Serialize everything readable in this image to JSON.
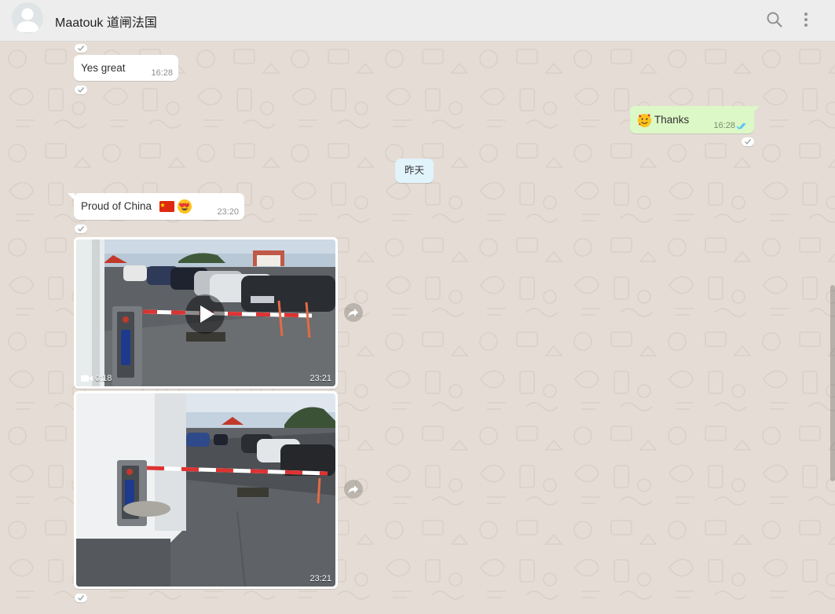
{
  "header": {
    "contact_name": "Maatouk 道闸法国",
    "icons": [
      "avatar-default-icon",
      "search-icon",
      "menu-dots-icon"
    ]
  },
  "messages": [
    {
      "dir": "in",
      "text": "Yes great",
      "time": "16:28"
    },
    {
      "dir": "out",
      "emoji": "smiling-face-with-hearts",
      "text": "Thanks",
      "time": "16:28",
      "status": "read"
    },
    {
      "type": "date",
      "text": "昨天"
    },
    {
      "dir": "in",
      "text": "Proud of China",
      "emojis": [
        "china-flag",
        "heart-eyes"
      ],
      "time": "23:20"
    },
    {
      "dir": "in",
      "type": "video",
      "duration": "0:18",
      "time": "23:21"
    },
    {
      "dir": "in",
      "type": "image",
      "time": "23:21"
    }
  ],
  "colors": {
    "header_bg": "#ededed",
    "chat_bg": "#e5ddd5",
    "incoming_bubble": "#ffffff",
    "outgoing_bubble": "#dcf8c6",
    "date_chip": "#e1f3fb",
    "read_ticks": "#4fc3f7"
  }
}
